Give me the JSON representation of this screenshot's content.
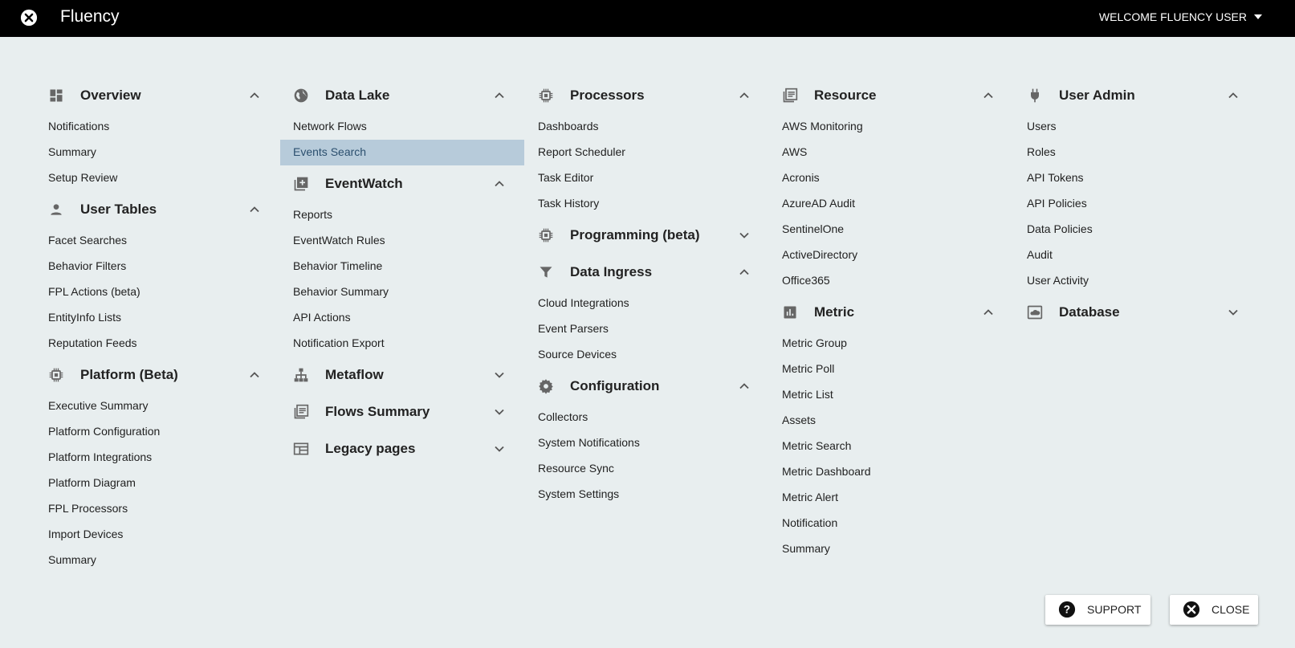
{
  "header": {
    "app_title": "Fluency",
    "welcome_text": "WELCOME FLUENCY USER",
    "close_icon": "close-circle-icon",
    "dropdown_icon": "caret-down-icon"
  },
  "columns": [
    {
      "sections": [
        {
          "title": "Overview",
          "icon": "dashboard-icon",
          "expanded": true,
          "items": [
            "Notifications",
            "Summary",
            "Setup Review"
          ]
        },
        {
          "title": "User Tables",
          "icon": "person-icon",
          "expanded": true,
          "items": [
            "Facet Searches",
            "Behavior Filters",
            "FPL Actions (beta)",
            "EntityInfo Lists",
            "Reputation Feeds"
          ]
        },
        {
          "title": "Platform (Beta)",
          "icon": "chip-icon",
          "expanded": true,
          "items": [
            "Executive Summary",
            "Platform Configuration",
            "Platform Integrations",
            "Platform Diagram",
            "FPL Processors",
            "Import Devices",
            "Summary"
          ]
        }
      ]
    },
    {
      "sections": [
        {
          "title": "Data Lake",
          "icon": "globe-icon",
          "expanded": true,
          "items": [
            "Network Flows",
            "Events Search"
          ],
          "active_item": "Events Search"
        },
        {
          "title": "EventWatch",
          "icon": "library-add-icon",
          "expanded": true,
          "items": [
            "Reports",
            "EventWatch Rules",
            "Behavior Timeline",
            "Behavior Summary",
            "API Actions",
            "Notification Export"
          ]
        },
        {
          "title": "Metaflow",
          "icon": "hierarchy-icon",
          "expanded": false,
          "items": []
        },
        {
          "title": "Flows Summary",
          "icon": "library-books-icon",
          "expanded": false,
          "items": []
        },
        {
          "title": "Legacy pages",
          "icon": "web-layout-icon",
          "expanded": false,
          "items": []
        }
      ]
    },
    {
      "sections": [
        {
          "title": "Processors",
          "icon": "chip-icon",
          "expanded": true,
          "items": [
            "Dashboards",
            "Report Scheduler",
            "Task Editor",
            "Task History"
          ]
        },
        {
          "title": "Programming (beta)",
          "icon": "chip-icon",
          "expanded": false,
          "items": []
        },
        {
          "title": "Data Ingress",
          "icon": "filter-icon",
          "expanded": true,
          "items": [
            "Cloud Integrations",
            "Event Parsers",
            "Source Devices"
          ]
        },
        {
          "title": "Configuration",
          "icon": "gear-icon",
          "expanded": true,
          "items": [
            "Collectors",
            "System Notifications",
            "Resource Sync",
            "System Settings"
          ]
        }
      ]
    },
    {
      "sections": [
        {
          "title": "Resource",
          "icon": "library-books-icon",
          "expanded": true,
          "items": [
            "AWS Monitoring",
            "AWS",
            "Acronis",
            "AzureAD Audit",
            "SentinelOne",
            "ActiveDirectory",
            "Office365"
          ]
        },
        {
          "title": "Metric",
          "icon": "bar-chart-icon",
          "expanded": true,
          "items": [
            "Metric Group",
            "Metric Poll",
            "Metric List",
            "Assets",
            "Metric Search",
            "Metric Dashboard",
            "Metric Alert",
            "Notification",
            "Summary"
          ]
        }
      ]
    },
    {
      "sections": [
        {
          "title": "User Admin",
          "icon": "plug-icon",
          "expanded": true,
          "items": [
            "Users",
            "Roles",
            "API Tokens",
            "API Policies",
            "Data Policies",
            "Audit",
            "User Activity"
          ]
        },
        {
          "title": "Database",
          "icon": "cloud-box-icon",
          "expanded": false,
          "items": []
        }
      ]
    }
  ],
  "footer": {
    "support_label": "SUPPORT",
    "support_icon": "help-circle-icon",
    "close_label": "CLOSE",
    "close_icon": "close-circle-icon"
  },
  "colors": {
    "topbar": "#000000",
    "background": "#e8eeef",
    "active_item_bg": "#b7cbda",
    "active_item_text": "#2b4f6e",
    "icon_gray": "#666666"
  }
}
